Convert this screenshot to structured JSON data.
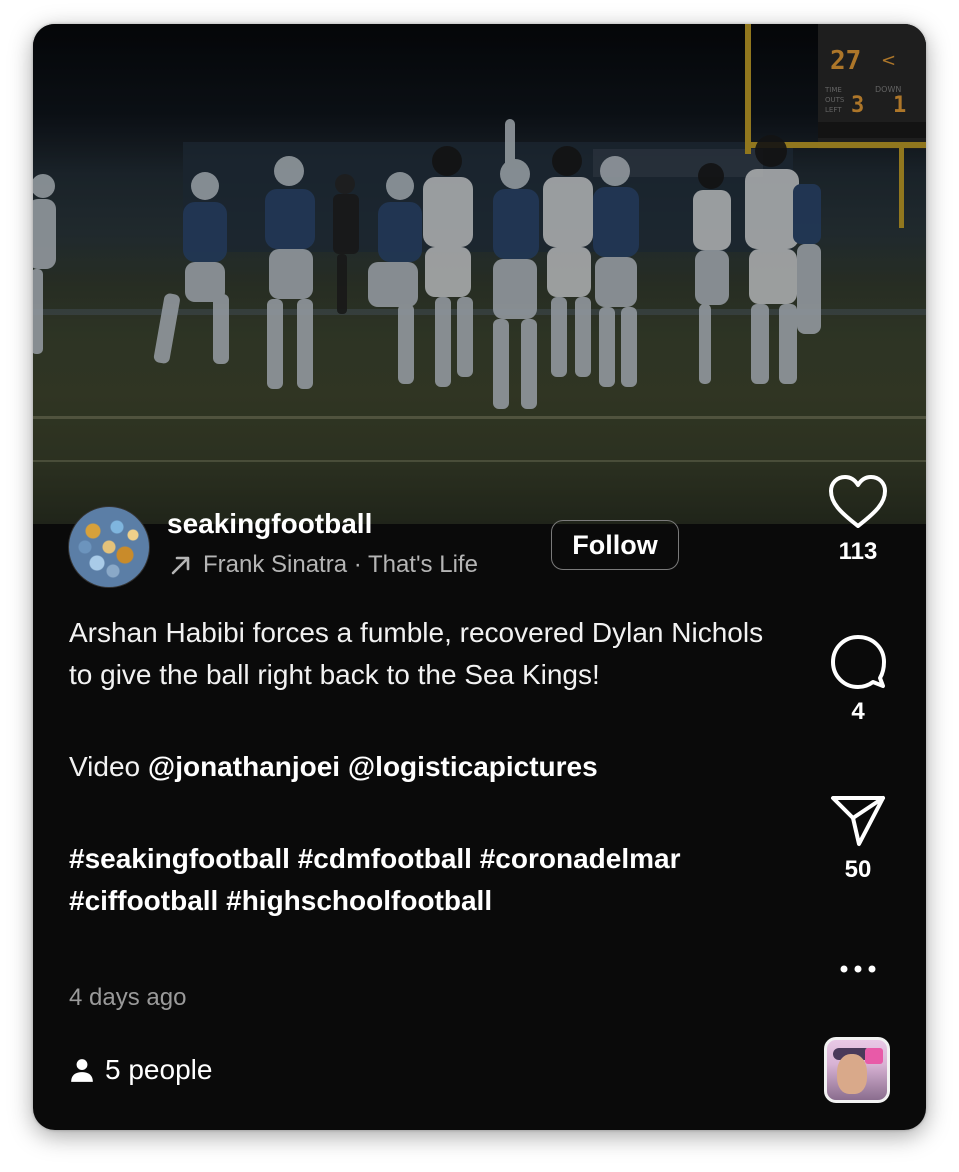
{
  "post": {
    "username": "seakingfootball",
    "audio": "Frank Sinatra · That's Life",
    "follow_label": "Follow",
    "caption_line1": "Arshan Habibi forces a fumble, recovered Dylan Nichols to give the ball right back to the Sea Kings!",
    "video_prefix": "Video ",
    "mention1": "@jonathanjoei",
    "mention2": "@logisticapictures",
    "hashtags": "#seakingfootball #cdmfootball #coronadelmar #ciffootball #highschoolfootball",
    "posted": "4 days ago",
    "people": "5 people"
  },
  "scoreboard": {
    "score": "27",
    "time_outs_left": "3",
    "down": "1",
    "tol_label": "TIME OUTS LEFT",
    "down_label": "DOWN"
  },
  "actions": {
    "likes": "113",
    "comments": "4",
    "shares": "50"
  },
  "icons": {
    "like": "heart-icon",
    "comment": "comment-bubble-icon",
    "share": "send-icon",
    "more": "more-dots-icon",
    "audio": "arrow-up-right-icon",
    "people": "person-icon"
  },
  "colors": {
    "background": "#0a0a0a",
    "text": "#ffffff",
    "muted": "#9a9a9a"
  }
}
